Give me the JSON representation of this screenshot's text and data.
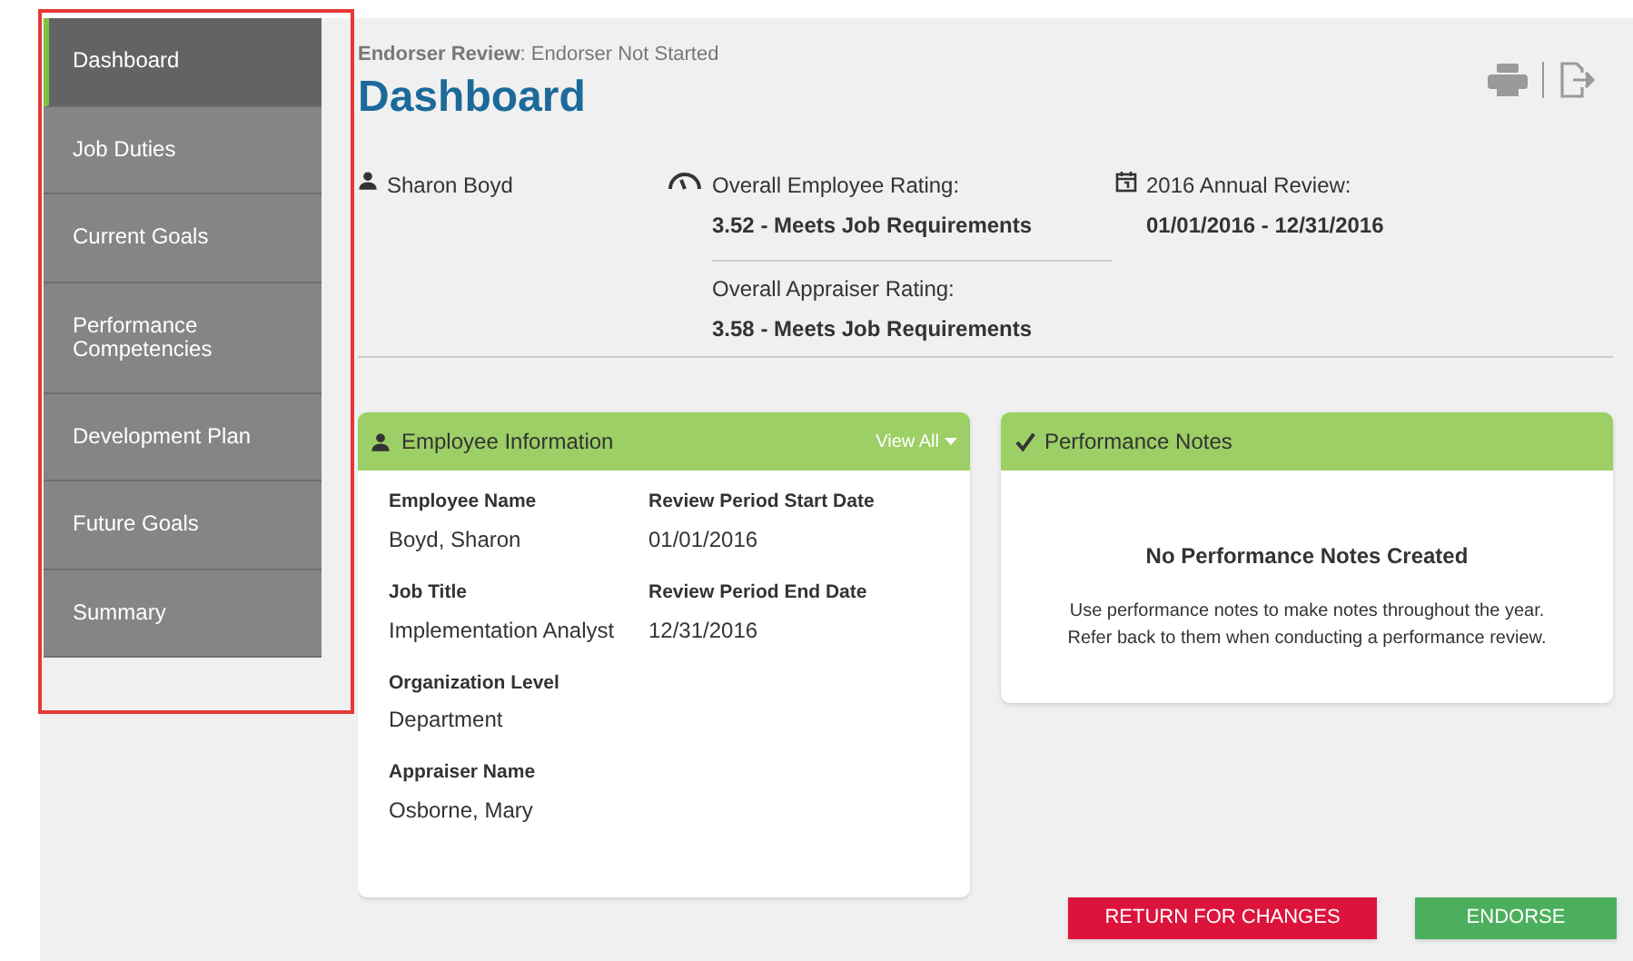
{
  "sidebar": {
    "items": [
      {
        "label": "Dashboard",
        "selected": true
      },
      {
        "label": "Job Duties",
        "selected": false
      },
      {
        "label": "Current Goals",
        "selected": false
      },
      {
        "label": "Performance Competencies",
        "selected": false
      },
      {
        "label": "Development Plan",
        "selected": false
      },
      {
        "label": "Future Goals",
        "selected": false
      },
      {
        "label": "Summary",
        "selected": false
      }
    ]
  },
  "header": {
    "status_label": "Endorser Review",
    "status_value": ": Endorser Not Started",
    "title": "Dashboard"
  },
  "summary": {
    "employee": "Sharon Boyd",
    "ratings": [
      {
        "label": "Overall Employee Rating:",
        "value": "3.52 - Meets Job Requirements"
      },
      {
        "label": "Overall Appraiser Rating:",
        "value": "3.58 - Meets Job Requirements"
      }
    ],
    "review": {
      "label": "2016 Annual Review:",
      "value": "01/01/2016 - 12/31/2016"
    }
  },
  "employee_info": {
    "title": "Employee Information",
    "view_all": "View All",
    "fields": [
      {
        "label": "Employee Name",
        "value": "Boyd, Sharon"
      },
      {
        "label": "Review Period Start Date",
        "value": "01/01/2016"
      },
      {
        "label": "Job Title",
        "value": "Implementation Analyst"
      },
      {
        "label": "Review Period End Date",
        "value": "12/31/2016"
      },
      {
        "label": "Organization Level",
        "value": "Department"
      },
      {
        "label": "Appraiser Name",
        "value": "Osborne, Mary"
      }
    ]
  },
  "performance_notes": {
    "title": "Performance Notes",
    "empty_title": "No Performance Notes Created",
    "empty_text": [
      "Use performance notes to make notes throughout the year.",
      "Refer back to them when conducting a performance review."
    ]
  },
  "buttons": [
    {
      "label": "RETURN FOR CHANGES",
      "kind": "danger"
    },
    {
      "label": "ENDORSE",
      "kind": "success"
    }
  ]
}
